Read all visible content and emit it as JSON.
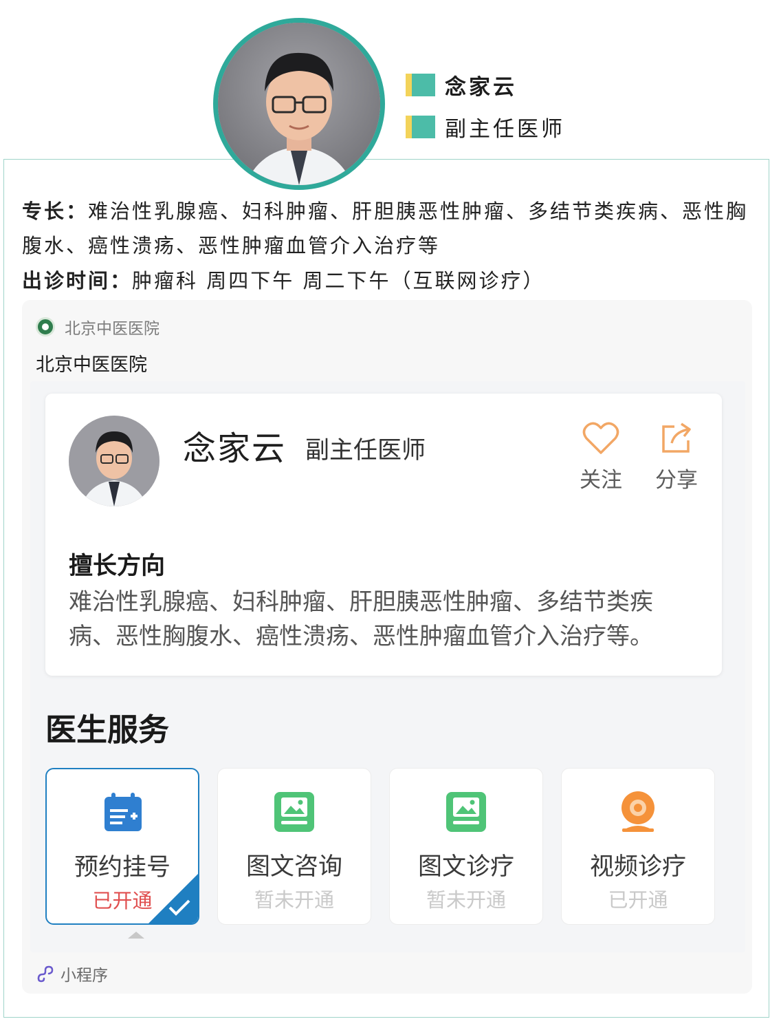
{
  "doctor": {
    "name": "念家云",
    "title": "副主任医师"
  },
  "intro": {
    "specialty_label": "专长：",
    "specialty_text": "难治性乳腺癌、妇科肿瘤、肝胆胰恶性肿瘤、多结节类疾病、恶性胸腹水、癌性溃疡、恶性肿瘤血管介入治疗等",
    "clinic_label": "出诊时间：",
    "clinic_text": "肿瘤科 周四下午 周二下午（互联网诊疗）"
  },
  "card": {
    "source": "北京中医医院",
    "title": "北京中医医院",
    "footer": "小程序",
    "screenshot": {
      "name": "念家云",
      "title": "副主任医师",
      "follow_label": "关注",
      "share_label": "分享",
      "good_heading": "擅长方向",
      "good_text": "难治性乳腺癌、妇科肿瘤、肝胆胰恶性肿瘤、多结节类疾病、恶性胸腹水、癌性溃疡、恶性肿瘤血管介入治疗等。",
      "services_heading": "医生服务",
      "services": [
        {
          "name": "预约挂号",
          "status": "已开通",
          "icon": "calendar-icon",
          "active": true
        },
        {
          "name": "图文咨询",
          "status": "暂未开通",
          "icon": "image-chat-icon",
          "active": false
        },
        {
          "name": "图文诊疗",
          "status": "暂未开通",
          "icon": "image-chat-icon",
          "active": false
        },
        {
          "name": "视频诊疗",
          "status": "已开通",
          "icon": "video-camera-icon",
          "active": false
        }
      ]
    }
  },
  "colors": {
    "accent_teal": "#2fa99a",
    "tag_yellow": "#f3d35a",
    "tag_green": "#4cbca8",
    "active_blue": "#1f7fc1",
    "open_red": "#e05050"
  }
}
